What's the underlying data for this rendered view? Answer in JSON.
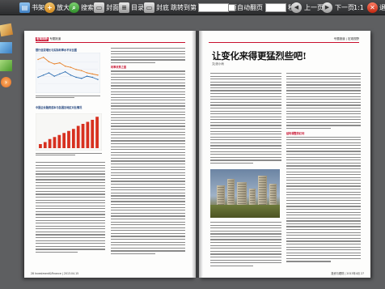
{
  "toolbar": {
    "bookshelf": "书架",
    "zoom_in": "放大",
    "search": "搜索",
    "cover": "封面",
    "toc": "目录",
    "back_cover": "封底",
    "goto_page": "跳转到第",
    "page_suffix": "页",
    "auto_flip": "自动翻页",
    "seconds": "秒",
    "prev_page": "上一页",
    "next_page": "下一页",
    "ratio": "1:1",
    "exit": "退出"
  },
  "left_page": {
    "header_tag": "宏观视野",
    "header_section": "专题报道",
    "figure1_caption": "银行信贷增长与实际利率水平对比图",
    "figure2_caption": "中国企业融资成本与各国及地区对比情况",
    "subheading": "利率改革之困",
    "footer": "28  Investment&Finance | 2013.04.15"
  },
  "right_page": {
    "header": "专题报道 | 宏观视野",
    "title": "让变化来得更猛烈些吧!",
    "byline": "文|张小雨",
    "subheading": "结构调整的红利",
    "footer": "投资与理财 | 2013年4月  27"
  },
  "chart_data": [
    {
      "type": "line",
      "title": "银行信贷增长与实际利率水平对比图",
      "series": [
        {
          "values": [
            28,
            30,
            26,
            24,
            25,
            22,
            21,
            19,
            18,
            16,
            15,
            14
          ]
        },
        {
          "values": [
            12,
            14,
            16,
            13,
            15,
            17,
            14,
            12,
            11,
            13,
            12,
            10
          ]
        }
      ],
      "colors": [
        "#e8822a",
        "#2f6fb3"
      ]
    },
    {
      "type": "bar",
      "title": "中国企业融资成本与各国及地区对比情况",
      "values": [
        4,
        6,
        9,
        11,
        13,
        15,
        17,
        19,
        22,
        24,
        26,
        28,
        31
      ],
      "colors": [
        "#d7301f"
      ]
    }
  ]
}
